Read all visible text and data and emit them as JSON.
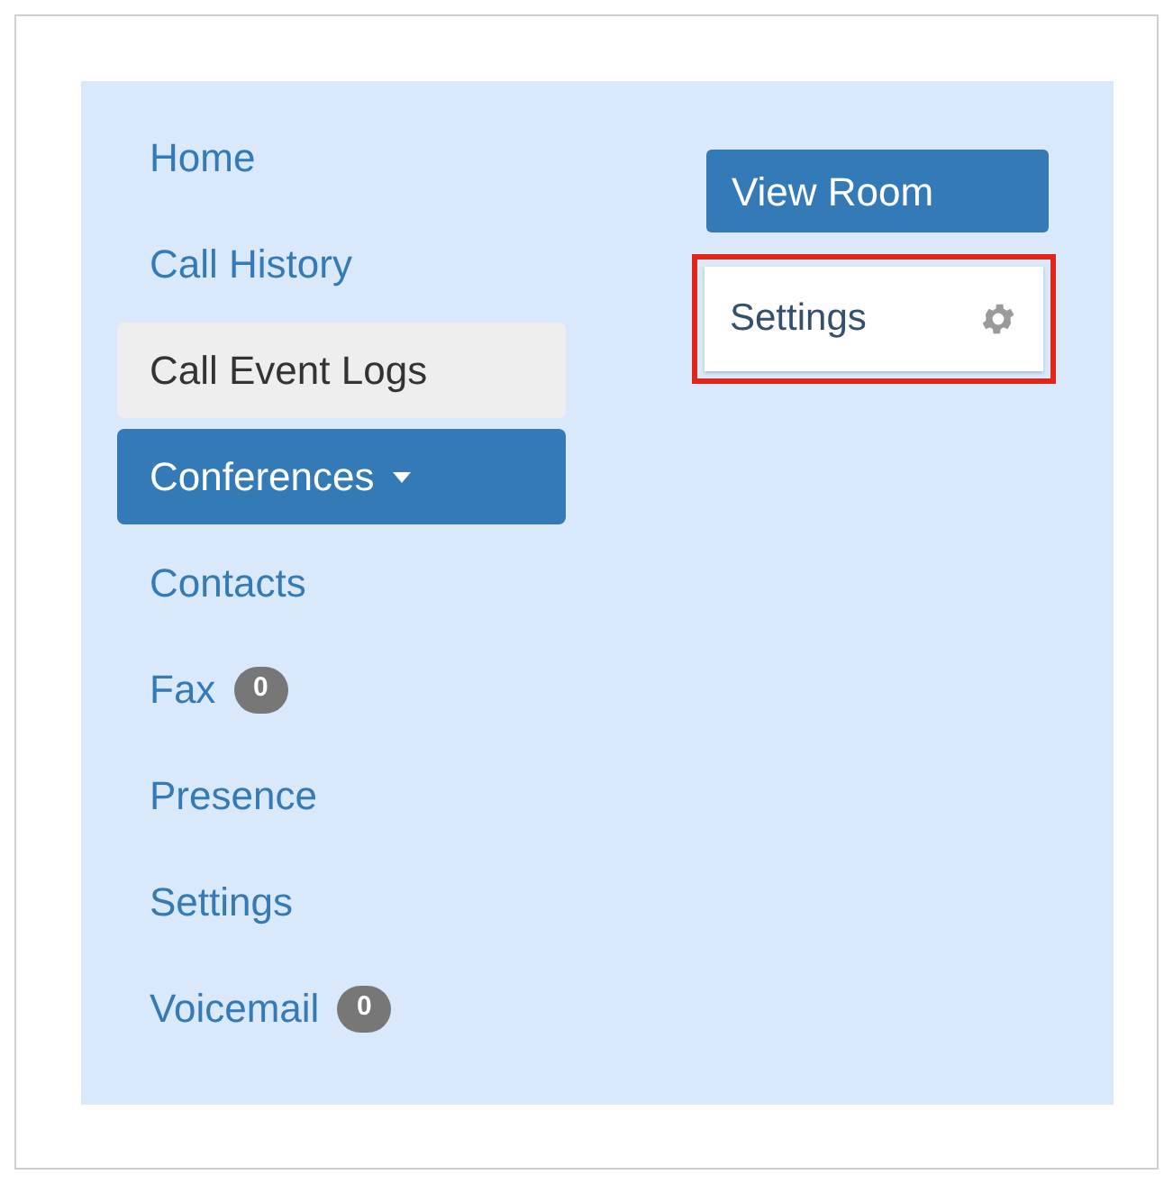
{
  "nav": [
    {
      "label": "Home",
      "selected": false,
      "hovered": false,
      "dropdown": false
    },
    {
      "label": "Call History",
      "selected": false,
      "hovered": false,
      "dropdown": false
    },
    {
      "label": "Call Event Logs",
      "selected": false,
      "hovered": true,
      "dropdown": false
    },
    {
      "label": "Conferences",
      "selected": true,
      "hovered": false,
      "dropdown": true
    },
    {
      "label": "Contacts",
      "selected": false,
      "hovered": false,
      "dropdown": false
    },
    {
      "label": "Fax",
      "selected": false,
      "hovered": false,
      "dropdown": false,
      "badge": "0"
    },
    {
      "label": "Presence",
      "selected": false,
      "hovered": false,
      "dropdown": false
    },
    {
      "label": "Settings",
      "selected": false,
      "hovered": false,
      "dropdown": false
    },
    {
      "label": "Voicemail",
      "selected": false,
      "hovered": false,
      "dropdown": false,
      "badge": "0"
    }
  ],
  "view_room_button": "View Room",
  "dropdown_menu": {
    "items": [
      {
        "label": "Settings",
        "outlined": true
      }
    ]
  }
}
